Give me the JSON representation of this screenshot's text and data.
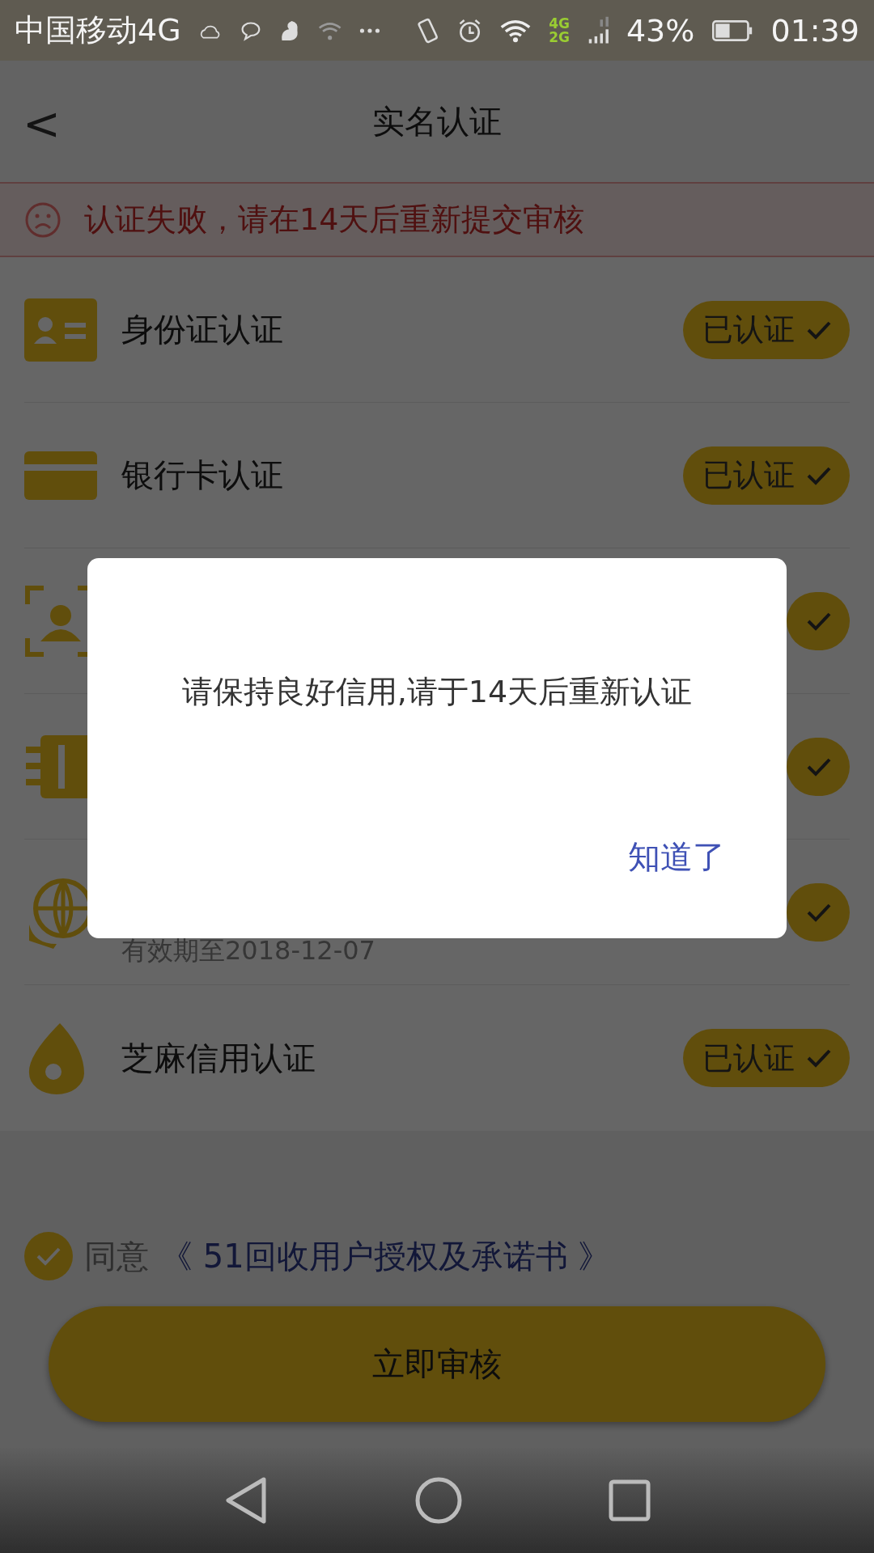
{
  "status_bar": {
    "carrier": "中国移动4G",
    "network_top": "4G",
    "network_bottom": "2G",
    "battery": "43%",
    "time": "01:39"
  },
  "header": {
    "back": "<",
    "title": "实名认证"
  },
  "alert": {
    "text": "认证失败，请在14天后重新提交审核"
  },
  "items": [
    {
      "title": "身份证认证",
      "badge": "已认证",
      "verified": true
    },
    {
      "title": "银行卡认证",
      "badge": "已认证",
      "verified": true
    },
    {
      "verified": true
    },
    {
      "verified": true
    },
    {
      "subtitle": "有效期至2018-12-07",
      "verified": true
    },
    {
      "title": "芝麻信用认证",
      "badge": "已认证",
      "verified": true
    }
  ],
  "agreement": {
    "checked": true,
    "prefix": "同意",
    "link": "《 51回收用户授权及承诺书 》"
  },
  "submit": {
    "label": "立即审核"
  },
  "dialog": {
    "message": "请保持良好信用,请于14天后重新认证",
    "button": "知道了"
  }
}
